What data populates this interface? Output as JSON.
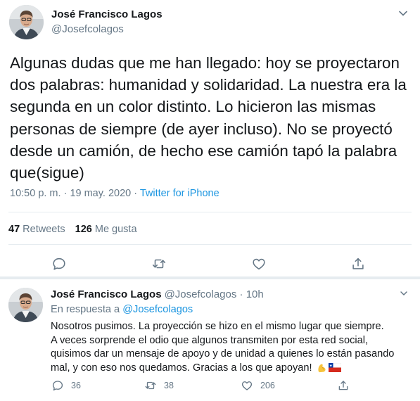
{
  "main_tweet": {
    "author_name": "José Francisco Lagos",
    "author_handle": "@Josefcolagos",
    "text": "Algunas dudas que me han llegado: hoy se proyectaron dos palabras: humanidad y solidaridad. La nuestra era la segunda en un color distinto. Lo hicieron las mismas personas de siempre (de ayer incluso). No se proyectó desde un camión, de hecho ese camión tapó la palabra que(sigue)",
    "time": "10:50 p. m.",
    "separator": " · ",
    "date": "19 may. 2020",
    "source": "Twitter for iPhone",
    "retweets_count": "47",
    "retweets_label": "Retweets",
    "likes_count": "126",
    "likes_label": "Me gusta"
  },
  "reply_tweet": {
    "author_name": "José Francisco Lagos",
    "author_handle": "@Josefcolagos",
    "time_separator": " · ",
    "relative_time": "10h",
    "in_reply_prefix": "En respuesta a ",
    "in_reply_mention": "@Josefcolagos",
    "line1": "Nosotros pusimos. La proyección se hizo en el mismo lugar que siempre.",
    "line2": "A veces sorprende el odio que algunos transmiten por esta red social,",
    "line3": "quisimos dar un mensaje de apoyo y de unidad a quienes lo están pasando",
    "line4": "mal, y con eso nos quedamos. Gracias a los que apoyan!",
    "emojis": [
      "flexed-biceps-emoji",
      "chile-flag-emoji"
    ],
    "reply_count": "36",
    "retweet_count": "38",
    "like_count": "206"
  },
  "colors": {
    "text": "#14171a",
    "secondary": "#657786",
    "link": "#1b95e0",
    "divider": "#e6ecf0"
  },
  "icons": {
    "main_actions": [
      "reply-icon",
      "retweet-icon",
      "like-icon",
      "share-icon"
    ],
    "menu": "chevron-down-icon"
  }
}
